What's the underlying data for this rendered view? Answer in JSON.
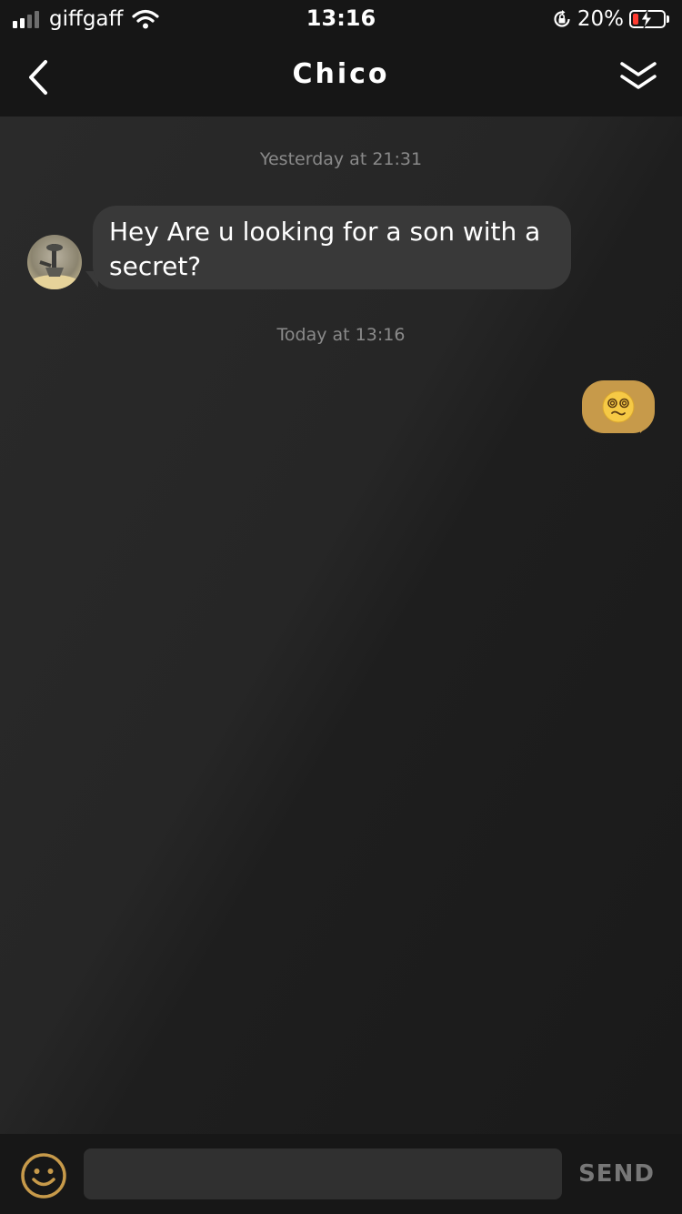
{
  "status_bar": {
    "carrier": "giffgaff",
    "time": "13:16",
    "battery_text": "20%",
    "battery_level": 0.2,
    "battery_color": "#ff3b30",
    "icons": [
      "signal-icon",
      "wifi-icon",
      "orientation-lock-icon",
      "battery-charging-icon"
    ]
  },
  "header": {
    "title": "Chico",
    "icons": [
      "back-chevron-icon",
      "collapse-double-chevron-icon"
    ]
  },
  "messages": [
    {
      "type": "timestamp",
      "text": "Yesterday at 21:31"
    },
    {
      "type": "incoming",
      "text": "Hey Are u looking for a son with a secret?"
    },
    {
      "type": "timestamp",
      "text": "Today at 13:16"
    },
    {
      "type": "outgoing",
      "emoji": "dizzy-face-emoji",
      "bubble_color": "#c79a4a"
    }
  ],
  "composer": {
    "input_value": "",
    "send_label": "SEND",
    "emoji_button_icon": "smiley-icon",
    "accent_color": "#c79a4a"
  }
}
